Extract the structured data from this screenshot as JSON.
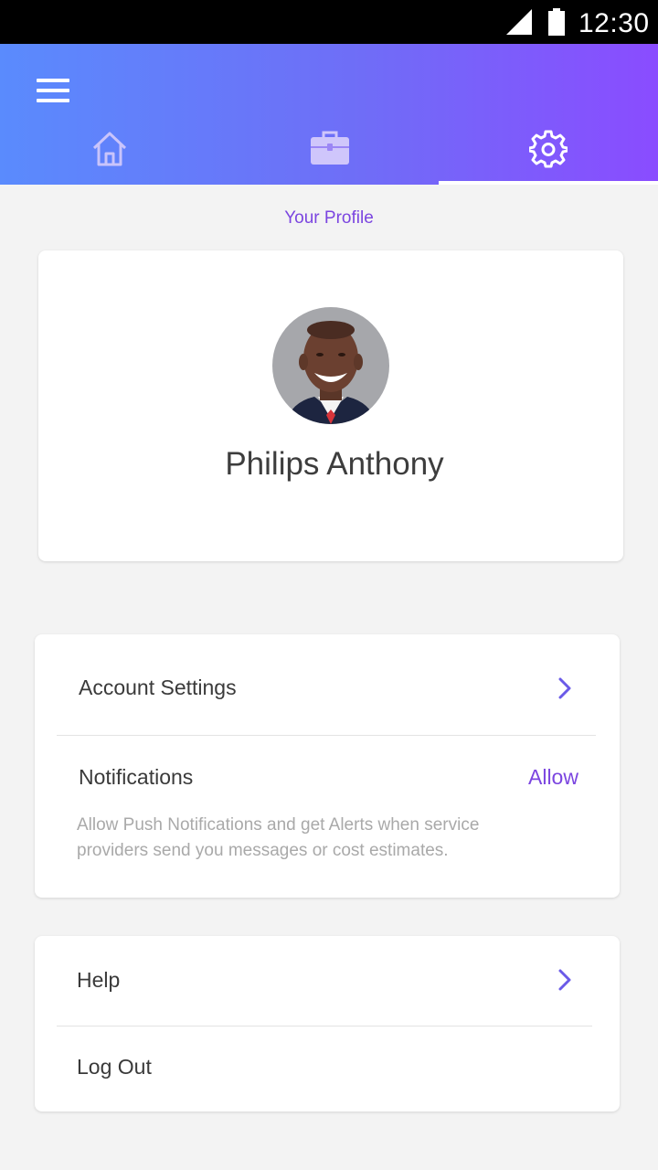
{
  "status_bar": {
    "time": "12:30",
    "icons": [
      "signal-icon",
      "battery-icon"
    ]
  },
  "header": {
    "menu_icon": "hamburger-menu-icon",
    "tabs": [
      {
        "icon": "home-icon",
        "active": false
      },
      {
        "icon": "briefcase-icon",
        "active": false
      },
      {
        "icon": "gear-icon",
        "active": true
      }
    ],
    "gradient": [
      "#5a8bfd",
      "#8a4cff"
    ]
  },
  "page_title": "Your Profile",
  "profile": {
    "name": "Philips Anthony",
    "avatar": "user-avatar-photo"
  },
  "settings": {
    "account_settings": "Account Settings",
    "notifications": "Notifications",
    "notifications_action": "Allow",
    "notifications_description": "Allow Push Notifications and get Alerts when service providers send you messages or cost estimates."
  },
  "support": {
    "help": "Help",
    "logout": "Log Out"
  },
  "colors": {
    "accent": "#7b45e0",
    "chevron": "#6a5ae8",
    "background": "#f3f3f3"
  }
}
